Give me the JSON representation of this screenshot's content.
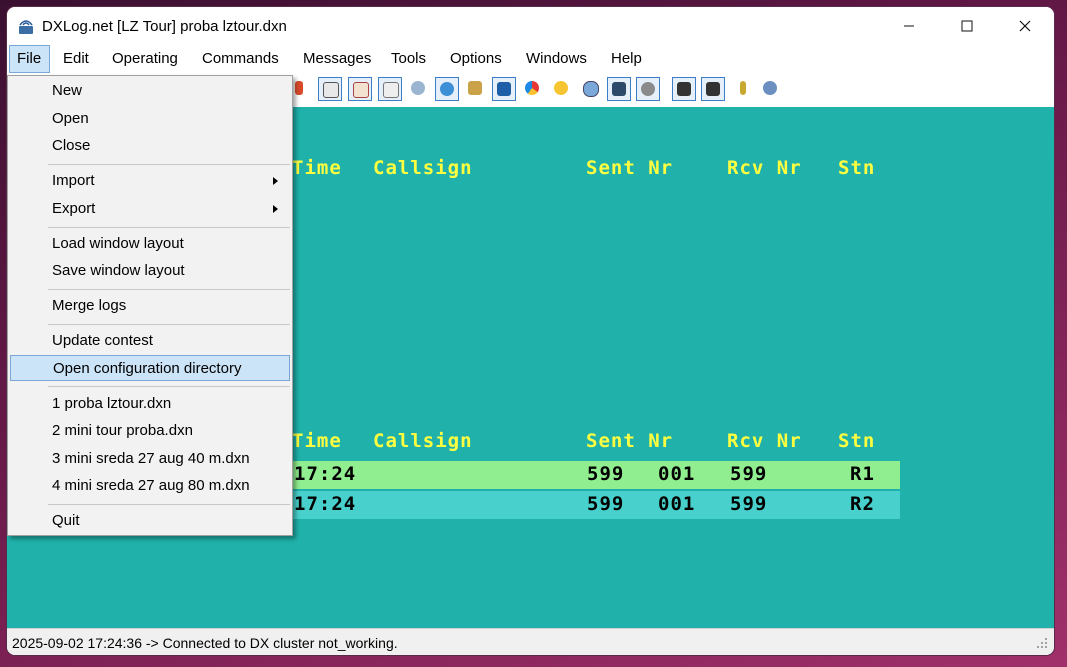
{
  "window": {
    "title": "DXLog.net [LZ Tour] proba lztour.dxn"
  },
  "menubar": [
    "File",
    "Edit",
    "Operating",
    "Commands",
    "Messages",
    "Tools",
    "Options",
    "Windows",
    "Help"
  ],
  "file_menu": {
    "new": "New",
    "open": "Open",
    "close": "Close",
    "import": "Import",
    "export": "Export",
    "load_layout": "Load window layout",
    "save_layout": "Save window layout",
    "merge_logs": "Merge logs",
    "update_contest": "Update contest",
    "open_config": "Open configuration directory",
    "recent": [
      "1 proba lztour.dxn",
      "2 mini tour proba.dxn",
      "3 mini sreda 27 aug 40 m.dxn",
      "4 mini sreda 27 aug 80 m.dxn"
    ],
    "quit": "Quit"
  },
  "log_headers": {
    "time": "Time",
    "callsign": "Callsign",
    "sent_nr": "Sent Nr",
    "rcv_nr": "Rcv Nr",
    "stn": "Stn"
  },
  "log_rows": [
    {
      "time": "17:24",
      "sent": "599",
      "nr": "001",
      "rcv": "599",
      "stn": "R1"
    },
    {
      "time": "17:24",
      "sent": "599",
      "nr": "001",
      "rcv": "599",
      "stn": "R2"
    }
  ],
  "status": {
    "text": "2025-09-02 17:24:36 -> Connected to DX cluster not_working."
  },
  "colors": {
    "grid_bg": "#20b2aa",
    "header_text": "#ffff40",
    "row1_bg": "#90ee90",
    "row2_bg": "#48d1cc",
    "highlight": "#cce4f7"
  }
}
